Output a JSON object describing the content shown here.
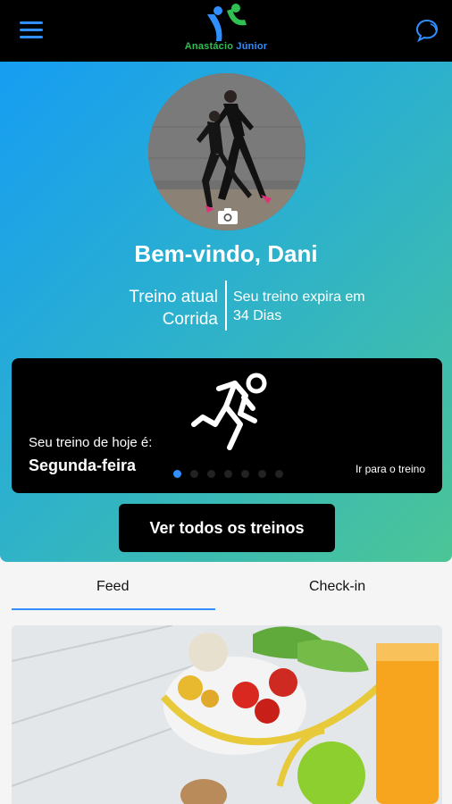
{
  "header": {
    "logo_text_main": "Anastácio",
    "logo_text_accent": "Júnior",
    "menu_icon": "hamburger-icon",
    "chat_icon": "chat-bubble-icon",
    "brand_blue": "#2f8fff",
    "brand_green": "#2fbf52"
  },
  "profile": {
    "welcome": "Bem-vindo, Dani",
    "plan_label": "Treino atual",
    "plan_name": "Corrida",
    "expiry_label": "Seu treino expira em",
    "expiry_value": "34 Dias",
    "camera_icon": "camera-icon"
  },
  "today_card": {
    "label": "Seu treino de hoje é:",
    "day": "Segunda-feira",
    "link": "Ir para o treino",
    "icon": "running-person-icon",
    "dots_total": 7,
    "dots_active": 0
  },
  "all_trainings_button": "Ver todos os treinos",
  "tabs": {
    "feed": "Feed",
    "checkin": "Check-in",
    "active": "Feed"
  }
}
